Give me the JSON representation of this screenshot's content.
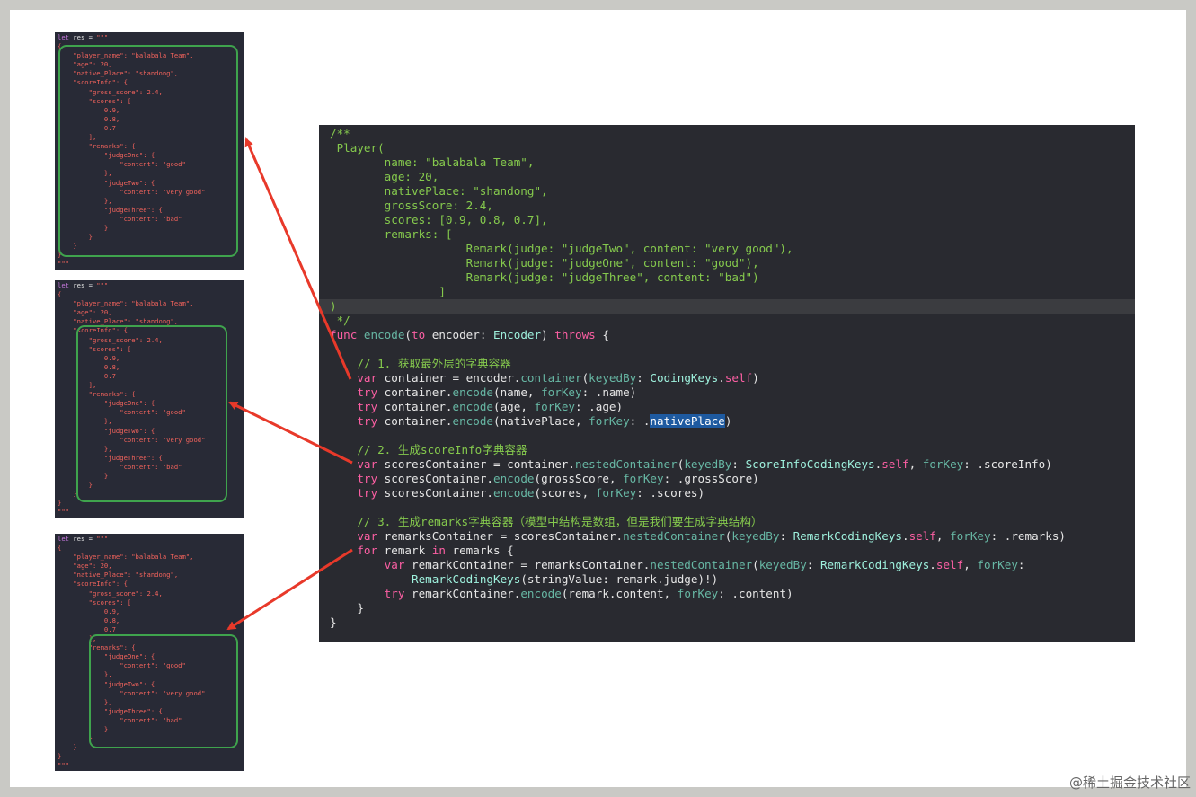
{
  "mini_code": [
    [
      [
        [
          "kw",
          "let"
        ],
        [
          "id",
          " res = "
        ],
        [
          "str",
          "\"\"\""
        ]
      ],
      [
        [
          "str",
          "{"
        ]
      ],
      [
        [
          "str",
          "    \"player_name\": \"balabala Team\","
        ]
      ],
      [
        [
          "str",
          "    \"age\": 20,"
        ]
      ],
      [
        [
          "str",
          "    \"native_Place\": \"shandong\","
        ]
      ],
      [
        [
          "str",
          "    \"scoreInfo\": {"
        ]
      ],
      [
        [
          "str",
          "        \"gross_score\": 2.4,"
        ]
      ],
      [
        [
          "str",
          "        \"scores\": ["
        ]
      ],
      [
        [
          "str",
          "            0.9,"
        ]
      ],
      [
        [
          "str",
          "            0.8,"
        ]
      ],
      [
        [
          "str",
          "            0.7"
        ]
      ],
      [
        [
          "str",
          "        ],"
        ]
      ],
      [
        [
          "str",
          "        \"remarks\": {"
        ]
      ],
      [
        [
          "str",
          "            \"judgeOne\": {"
        ]
      ],
      [
        [
          "str",
          "                \"content\": \"good\""
        ]
      ],
      [
        [
          "str",
          "            },"
        ]
      ],
      [
        [
          "str",
          "            \"judgeTwo\": {"
        ]
      ],
      [
        [
          "str",
          "                \"content\": \"very good\""
        ]
      ],
      [
        [
          "str",
          "            },"
        ]
      ],
      [
        [
          "str",
          "            \"judgeThree\": {"
        ]
      ],
      [
        [
          "str",
          "                \"content\": \"bad\""
        ]
      ],
      [
        [
          "str",
          "            }"
        ]
      ],
      [
        [
          "str",
          "        }"
        ]
      ],
      [
        [
          "str",
          "    }"
        ]
      ],
      [
        [
          "str",
          "}"
        ]
      ],
      [
        [
          "str",
          "\"\"\""
        ]
      ]
    ]
  ],
  "main_code": [
    [
      [
        "cm",
        "/**"
      ]
    ],
    [
      [
        "cm",
        " Player("
      ]
    ],
    [
      [
        "cm",
        "        name: \"balabala Team\","
      ]
    ],
    [
      [
        "cm",
        "        age: 20,"
      ]
    ],
    [
      [
        "cm",
        "        nativePlace: \"shandong\","
      ]
    ],
    [
      [
        "cm",
        "        grossScore: 2.4,"
      ]
    ],
    [
      [
        "cm",
        "        scores: [0.9, 0.8, 0.7],"
      ]
    ],
    [
      [
        "cm",
        "        remarks: ["
      ]
    ],
    [
      [
        "cm",
        "                    Remark(judge: \"judgeTwo\", content: \"very good\"),"
      ]
    ],
    [
      [
        "cm",
        "                    Remark(judge: \"judgeOne\", content: \"good\"),"
      ]
    ],
    [
      [
        "cm",
        "                    Remark(judge: \"judgeThree\", content: \"bad\")"
      ]
    ],
    [
      [
        "cm",
        "                ]"
      ]
    ],
    [
      [
        "cm",
        ")"
      ]
    ],
    [
      [
        "cm",
        " */"
      ]
    ],
    [
      [
        "kw",
        "func "
      ],
      [
        "fn",
        "encode"
      ],
      [
        "op",
        "("
      ],
      [
        "kw",
        "to"
      ],
      [
        "op",
        " encoder: "
      ],
      [
        "ty",
        "Encoder"
      ],
      [
        "op",
        ") "
      ],
      [
        "kw",
        "throws"
      ],
      [
        "op",
        " {"
      ]
    ],
    [
      [
        "op",
        ""
      ]
    ],
    [
      [
        "cm",
        "    // 1. 获取最外层的字典容器"
      ]
    ],
    [
      [
        "op",
        "    "
      ],
      [
        "kw",
        "var"
      ],
      [
        "op",
        " container = encoder."
      ],
      [
        "fn",
        "container"
      ],
      [
        "op",
        "("
      ],
      [
        "fn",
        "keyedBy"
      ],
      [
        "op",
        ": "
      ],
      [
        "ty",
        "CodingKeys"
      ],
      [
        "op",
        "."
      ],
      [
        "kw",
        "self"
      ],
      [
        "op",
        ")"
      ]
    ],
    [
      [
        "op",
        "    "
      ],
      [
        "kw",
        "try"
      ],
      [
        "op",
        " container."
      ],
      [
        "fn",
        "encode"
      ],
      [
        "op",
        "(name, "
      ],
      [
        "fn",
        "forKey"
      ],
      [
        "op",
        ": .name)"
      ]
    ],
    [
      [
        "op",
        "    "
      ],
      [
        "kw",
        "try"
      ],
      [
        "op",
        " container."
      ],
      [
        "fn",
        "encode"
      ],
      [
        "op",
        "(age, "
      ],
      [
        "fn",
        "forKey"
      ],
      [
        "op",
        ": .age)"
      ]
    ],
    [
      [
        "op",
        "    "
      ],
      [
        "kw",
        "try"
      ],
      [
        "op",
        " container."
      ],
      [
        "fn",
        "encode"
      ],
      [
        "op",
        "(nativePlace, "
      ],
      [
        "fn",
        "forKey"
      ],
      [
        "op",
        ": ."
      ],
      [
        "sel",
        "nativePlace"
      ],
      [
        "op",
        ")"
      ]
    ],
    [
      [
        "op",
        ""
      ]
    ],
    [
      [
        "cm",
        "    // 2. 生成scoreInfo字典容器"
      ]
    ],
    [
      [
        "op",
        "    "
      ],
      [
        "kw",
        "var"
      ],
      [
        "op",
        " scoresContainer = container."
      ],
      [
        "fn",
        "nestedContainer"
      ],
      [
        "op",
        "("
      ],
      [
        "fn",
        "keyedBy"
      ],
      [
        "op",
        ": "
      ],
      [
        "ty",
        "ScoreInfoCodingKeys"
      ],
      [
        "op",
        "."
      ],
      [
        "kw",
        "self"
      ],
      [
        "op",
        ", "
      ],
      [
        "fn",
        "forKey"
      ],
      [
        "op",
        ": .scoreInfo)"
      ]
    ],
    [
      [
        "op",
        "    "
      ],
      [
        "kw",
        "try"
      ],
      [
        "op",
        " scoresContainer."
      ],
      [
        "fn",
        "encode"
      ],
      [
        "op",
        "(grossScore, "
      ],
      [
        "fn",
        "forKey"
      ],
      [
        "op",
        ": .grossScore)"
      ]
    ],
    [
      [
        "op",
        "    "
      ],
      [
        "kw",
        "try"
      ],
      [
        "op",
        " scoresContainer."
      ],
      [
        "fn",
        "encode"
      ],
      [
        "op",
        "(scores, "
      ],
      [
        "fn",
        "forKey"
      ],
      [
        "op",
        ": .scores)"
      ]
    ],
    [
      [
        "op",
        ""
      ]
    ],
    [
      [
        "cm",
        "    // 3. 生成remarks字典容器（模型中结构是数组，但是我们要生成字典结构）"
      ]
    ],
    [
      [
        "op",
        "    "
      ],
      [
        "kw",
        "var"
      ],
      [
        "op",
        " remarksContainer = scoresContainer."
      ],
      [
        "fn",
        "nestedContainer"
      ],
      [
        "op",
        "("
      ],
      [
        "fn",
        "keyedBy"
      ],
      [
        "op",
        ": "
      ],
      [
        "ty",
        "RemarkCodingKeys"
      ],
      [
        "op",
        "."
      ],
      [
        "kw",
        "self"
      ],
      [
        "op",
        ", "
      ],
      [
        "fn",
        "forKey"
      ],
      [
        "op",
        ": .remarks)"
      ]
    ],
    [
      [
        "op",
        "    "
      ],
      [
        "kw",
        "for"
      ],
      [
        "op",
        " remark "
      ],
      [
        "kw",
        "in"
      ],
      [
        "op",
        " remarks {"
      ]
    ],
    [
      [
        "op",
        "        "
      ],
      [
        "kw",
        "var"
      ],
      [
        "op",
        " remarkContainer = remarksContainer."
      ],
      [
        "fn",
        "nestedContainer"
      ],
      [
        "op",
        "("
      ],
      [
        "fn",
        "keyedBy"
      ],
      [
        "op",
        ": "
      ],
      [
        "ty",
        "RemarkCodingKeys"
      ],
      [
        "op",
        "."
      ],
      [
        "kw",
        "self"
      ],
      [
        "op",
        ", "
      ],
      [
        "fn",
        "forKey"
      ],
      [
        "op",
        ":"
      ]
    ],
    [
      [
        "op",
        "            "
      ],
      [
        "ty",
        "RemarkCodingKeys"
      ],
      [
        "op",
        "(stringValue: remark.judge)!)"
      ]
    ],
    [
      [
        "op",
        "        "
      ],
      [
        "kw",
        "try"
      ],
      [
        "op",
        " remarkContainer."
      ],
      [
        "fn",
        "encode"
      ],
      [
        "op",
        "(remark.content, "
      ],
      [
        "fn",
        "forKey"
      ],
      [
        "op",
        ": .content)"
      ]
    ],
    [
      [
        "op",
        "    }"
      ]
    ],
    [
      [
        "op",
        "}"
      ]
    ]
  ],
  "watermark": "@稀土掘金技术社区"
}
